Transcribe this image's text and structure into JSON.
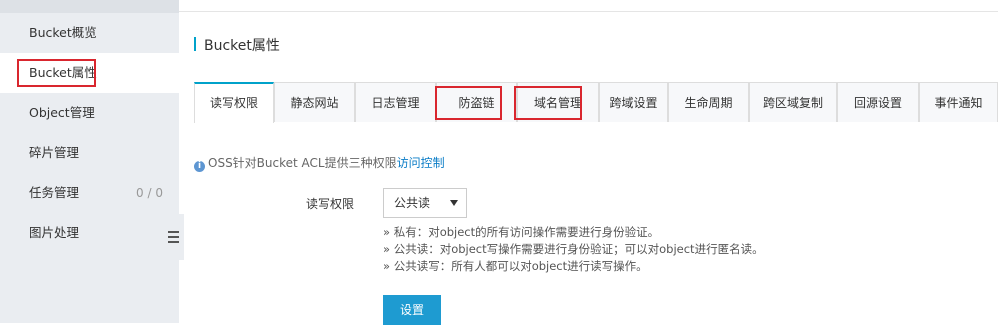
{
  "sidebar": {
    "items": [
      {
        "label": "Bucket概览"
      },
      {
        "label": "Bucket属性"
      },
      {
        "label": "Object管理"
      },
      {
        "label": "碎片管理"
      },
      {
        "label": "任务管理",
        "count": "0 / 0"
      },
      {
        "label": "图片处理"
      }
    ],
    "active_index": 1,
    "collapse_handle_icon": "menu-icon"
  },
  "section": {
    "title": "Bucket属性"
  },
  "tabs": [
    {
      "label": "读写权限"
    },
    {
      "label": "静态网站"
    },
    {
      "label": "日志管理"
    },
    {
      "label": "防盗链"
    },
    {
      "label": "域名管理"
    },
    {
      "label": "跨域设置"
    },
    {
      "label": "生命周期"
    },
    {
      "label": "跨区域复制"
    },
    {
      "label": "回源设置"
    },
    {
      "label": "事件通知"
    }
  ],
  "active_tab_index": 0,
  "info": {
    "icon": "info-icon",
    "text": "OSS针对Bucket ACL提供三种权限",
    "link": "访问控制"
  },
  "form": {
    "label": "读写权限",
    "select_value": "公共读",
    "notes": [
      "» 私有：对object的所有访问操作需要进行身份验证。",
      "» 公共读：对object写操作需要进行身份验证；可以对object进行匿名读。",
      "» 公共读写：所有人都可以对object进行读写操作。"
    ],
    "submit_label": "设置"
  },
  "colors": {
    "accent": "#00a2ca",
    "highlight_box": "#d9262e",
    "button": "#1e9bd1",
    "sidebar_bg": "#eaedf1"
  }
}
